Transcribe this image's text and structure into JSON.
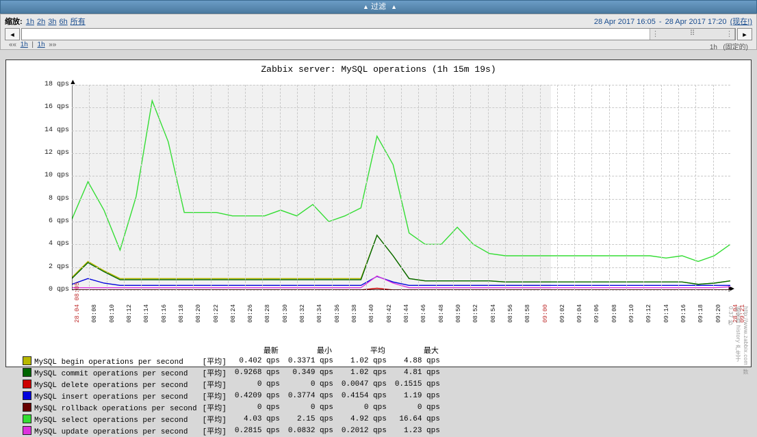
{
  "filter": {
    "title": "过滤",
    "caret": "▲"
  },
  "zoom": {
    "label": "缩放:",
    "links": [
      "1h",
      "2h",
      "3h",
      "6h",
      "所有"
    ],
    "range_from": "28 Apr 2017 16:05",
    "range_sep": "-",
    "range_to": "28 Apr 2017 17:20",
    "now": "(现在!)"
  },
  "below": {
    "left_prev": "««",
    "l1": "1h",
    "sep": "|",
    "l2": "1h",
    "next": "»»",
    "r1": "1h",
    "r2": "(固定的)"
  },
  "chart_title": "Zabbix server: MySQL operations (1h 15m 19s)",
  "legend_headers": {
    "latest": "最新",
    "min": "最小",
    "avg": "平均",
    "max": "最大"
  },
  "agg_label": "[平均]",
  "unit": "qps",
  "legend": [
    {
      "name": "MySQL begin operations per second",
      "color": "#b8b800",
      "latest": "0.402 qps",
      "min": "0.3371 qps",
      "avg": "1.02 qps",
      "max": "4.88 qps"
    },
    {
      "name": "MySQL commit operations per second",
      "color": "#006600",
      "latest": "0.9268 qps",
      "min": "0.349 qps",
      "avg": "1.02 qps",
      "max": "4.81 qps"
    },
    {
      "name": "MySQL delete operations per second",
      "color": "#cc0000",
      "latest": "0 qps",
      "min": "0 qps",
      "avg": "0.0047 qps",
      "max": "0.1515 qps"
    },
    {
      "name": "MySQL insert operations per second",
      "color": "#0000dd",
      "latest": "0.4209 qps",
      "min": "0.3774 qps",
      "avg": "0.4154 qps",
      "max": "1.19 qps"
    },
    {
      "name": "MySQL rollback operations per second",
      "color": "#660000",
      "latest": "0 qps",
      "min": "0 qps",
      "avg": "0 qps",
      "max": "0 qps"
    },
    {
      "name": "MySQL select operations per second",
      "color": "#33dd33",
      "latest": "4.03 qps",
      "min": "2.15 qps",
      "avg": "4.92 qps",
      "max": "16.64 qps"
    },
    {
      "name": "MySQL update operations per second",
      "color": "#dd33dd",
      "latest": "0.2815 qps",
      "min": "0.0832 qps",
      "avg": "0.2012 qps",
      "max": "1.23 qps"
    }
  ],
  "footer_note": "数据来自 history  产生于 0.37 秒",
  "footer_url": "http://www.zabbix.com",
  "chart_data": {
    "type": "line",
    "title": "Zabbix server: MySQL operations (1h 15m 19s)",
    "xlabel": "",
    "ylabel": "qps",
    "ylim": [
      0,
      18
    ],
    "yticks": [
      0,
      2,
      4,
      6,
      8,
      10,
      12,
      14,
      16,
      18
    ],
    "xticks": [
      "28.04 08:05",
      "08:08",
      "08:10",
      "08:12",
      "08:14",
      "08:16",
      "08:18",
      "08:20",
      "08:22",
      "08:24",
      "08:26",
      "08:28",
      "08:30",
      "08:32",
      "08:34",
      "08:36",
      "08:38",
      "08:40",
      "08:42",
      "08:44",
      "08:46",
      "08:48",
      "08:50",
      "08:52",
      "08:54",
      "08:56",
      "08:58",
      "09:00",
      "09:02",
      "09:04",
      "09:06",
      "09:08",
      "09:10",
      "09:12",
      "09:14",
      "09:16",
      "09:18",
      "09:20",
      "28.04 09:21"
    ],
    "series": [
      {
        "name": "MySQL select operations per second",
        "color": "#33dd33",
        "values": [
          6.2,
          9.5,
          7.0,
          3.5,
          8.2,
          16.6,
          13.0,
          6.8,
          6.8,
          6.8,
          6.5,
          6.5,
          6.5,
          7.0,
          6.5,
          7.5,
          6.0,
          6.5,
          7.2,
          13.5,
          11.0,
          5.0,
          4.0,
          4.0,
          5.5,
          4.0,
          3.2,
          3.0,
          3.0,
          3.0,
          3.0,
          3.0,
          3.0,
          3.0,
          3.0,
          3.0,
          3.0,
          2.8,
          3.0,
          2.5,
          3.0,
          4.0
        ]
      },
      {
        "name": "MySQL begin operations per second",
        "color": "#b8b800",
        "values": [
          1.1,
          2.5,
          1.7,
          1.0,
          1.0,
          1.0,
          1.0,
          1.0,
          1.0,
          1.0,
          1.0,
          1.0,
          1.0,
          1.0,
          1.0,
          1.0,
          1.0,
          1.0,
          1.0,
          4.8,
          3.0,
          1.0,
          0.8,
          0.8,
          0.8,
          0.8,
          0.8,
          0.7,
          0.7,
          0.7,
          0.7,
          0.7,
          0.7,
          0.7,
          0.7,
          0.7,
          0.7,
          0.7,
          0.7,
          0.5,
          0.6,
          0.8
        ]
      },
      {
        "name": "MySQL commit operations per second",
        "color": "#006600",
        "values": [
          1.0,
          2.4,
          1.6,
          0.9,
          0.9,
          0.9,
          0.9,
          0.9,
          0.9,
          0.9,
          0.9,
          0.9,
          0.9,
          0.9,
          0.9,
          0.9,
          0.9,
          0.9,
          0.9,
          4.8,
          3.0,
          1.0,
          0.8,
          0.8,
          0.8,
          0.8,
          0.8,
          0.7,
          0.7,
          0.7,
          0.7,
          0.7,
          0.7,
          0.7,
          0.7,
          0.7,
          0.7,
          0.7,
          0.7,
          0.5,
          0.6,
          0.8
        ]
      },
      {
        "name": "MySQL insert operations per second",
        "color": "#0000dd",
        "values": [
          0.5,
          1.0,
          0.6,
          0.4,
          0.4,
          0.4,
          0.4,
          0.4,
          0.4,
          0.4,
          0.4,
          0.4,
          0.4,
          0.4,
          0.4,
          0.4,
          0.4,
          0.4,
          0.4,
          1.19,
          0.7,
          0.4,
          0.4,
          0.4,
          0.4,
          0.4,
          0.4,
          0.4,
          0.4,
          0.4,
          0.4,
          0.4,
          0.4,
          0.4,
          0.4,
          0.4,
          0.4,
          0.4,
          0.4,
          0.4,
          0.4,
          0.4
        ]
      },
      {
        "name": "MySQL update operations per second",
        "color": "#dd33dd",
        "values": [
          0.2,
          0.2,
          0.2,
          0.2,
          0.2,
          0.2,
          0.2,
          0.2,
          0.2,
          0.2,
          0.2,
          0.2,
          0.2,
          0.2,
          0.2,
          0.2,
          0.2,
          0.2,
          0.2,
          1.23,
          0.6,
          0.2,
          0.2,
          0.2,
          0.2,
          0.2,
          0.2,
          0.2,
          0.2,
          0.2,
          0.2,
          0.2,
          0.2,
          0.2,
          0.2,
          0.2,
          0.2,
          0.2,
          0.2,
          0.2,
          0.2,
          0.28
        ]
      },
      {
        "name": "MySQL delete operations per second",
        "color": "#cc0000",
        "values": [
          0,
          0,
          0,
          0,
          0,
          0,
          0,
          0,
          0,
          0,
          0,
          0,
          0,
          0,
          0,
          0,
          0,
          0,
          0,
          0.15,
          0,
          0,
          0,
          0,
          0,
          0,
          0,
          0,
          0,
          0,
          0,
          0,
          0,
          0,
          0,
          0,
          0,
          0,
          0,
          0,
          0,
          0
        ]
      },
      {
        "name": "MySQL rollback operations per second",
        "color": "#660000",
        "values": [
          0,
          0,
          0,
          0,
          0,
          0,
          0,
          0,
          0,
          0,
          0,
          0,
          0,
          0,
          0,
          0,
          0,
          0,
          0,
          0,
          0,
          0,
          0,
          0,
          0,
          0,
          0,
          0,
          0,
          0,
          0,
          0,
          0,
          0,
          0,
          0,
          0,
          0,
          0,
          0,
          0,
          0
        ]
      }
    ]
  }
}
